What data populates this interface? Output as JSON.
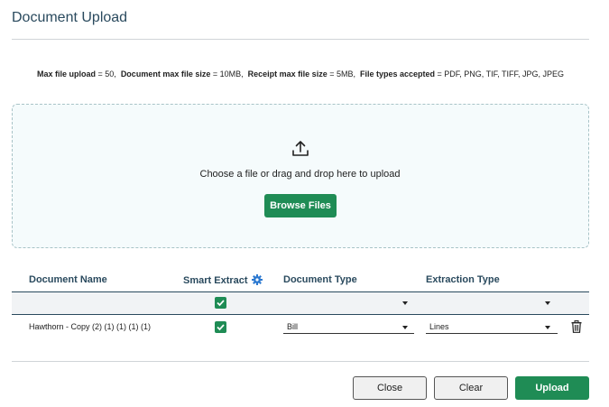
{
  "dialog": {
    "title": "Document Upload"
  },
  "limits": {
    "max_upload_label": "Max file upload",
    "max_upload_value": " = 50,",
    "doc_size_label": "Document max file size",
    "doc_size_value": " = 10MB,",
    "receipt_size_label": "Receipt max file size",
    "receipt_size_value": " = 5MB,",
    "types_label": "File types accepted",
    "types_value": " = PDF, PNG, TIF, TIFF, JPG, JPEG"
  },
  "dropzone": {
    "icon": "upload-icon",
    "text": "Choose a file or drag and drop here to upload",
    "browse_label": "Browse Files"
  },
  "table": {
    "headers": {
      "document_name": "Document Name",
      "smart_extract": "Smart Extract",
      "document_type": "Document Type",
      "extraction_type": "Extraction Type"
    },
    "filter_row": {
      "smart_extract_checked": true
    },
    "rows": [
      {
        "document_name": "Hawthorn - Copy (2) (1) (1) (1) (1)",
        "smart_extract_checked": true,
        "document_type": "Bill",
        "extraction_type": "Lines"
      }
    ]
  },
  "footer": {
    "close_label": "Close",
    "clear_label": "Clear",
    "upload_label": "Upload"
  },
  "colors": {
    "accent_green": "#1f8c55",
    "heading_blue": "#2a4a5e",
    "gear_blue": "#2b78d0"
  }
}
